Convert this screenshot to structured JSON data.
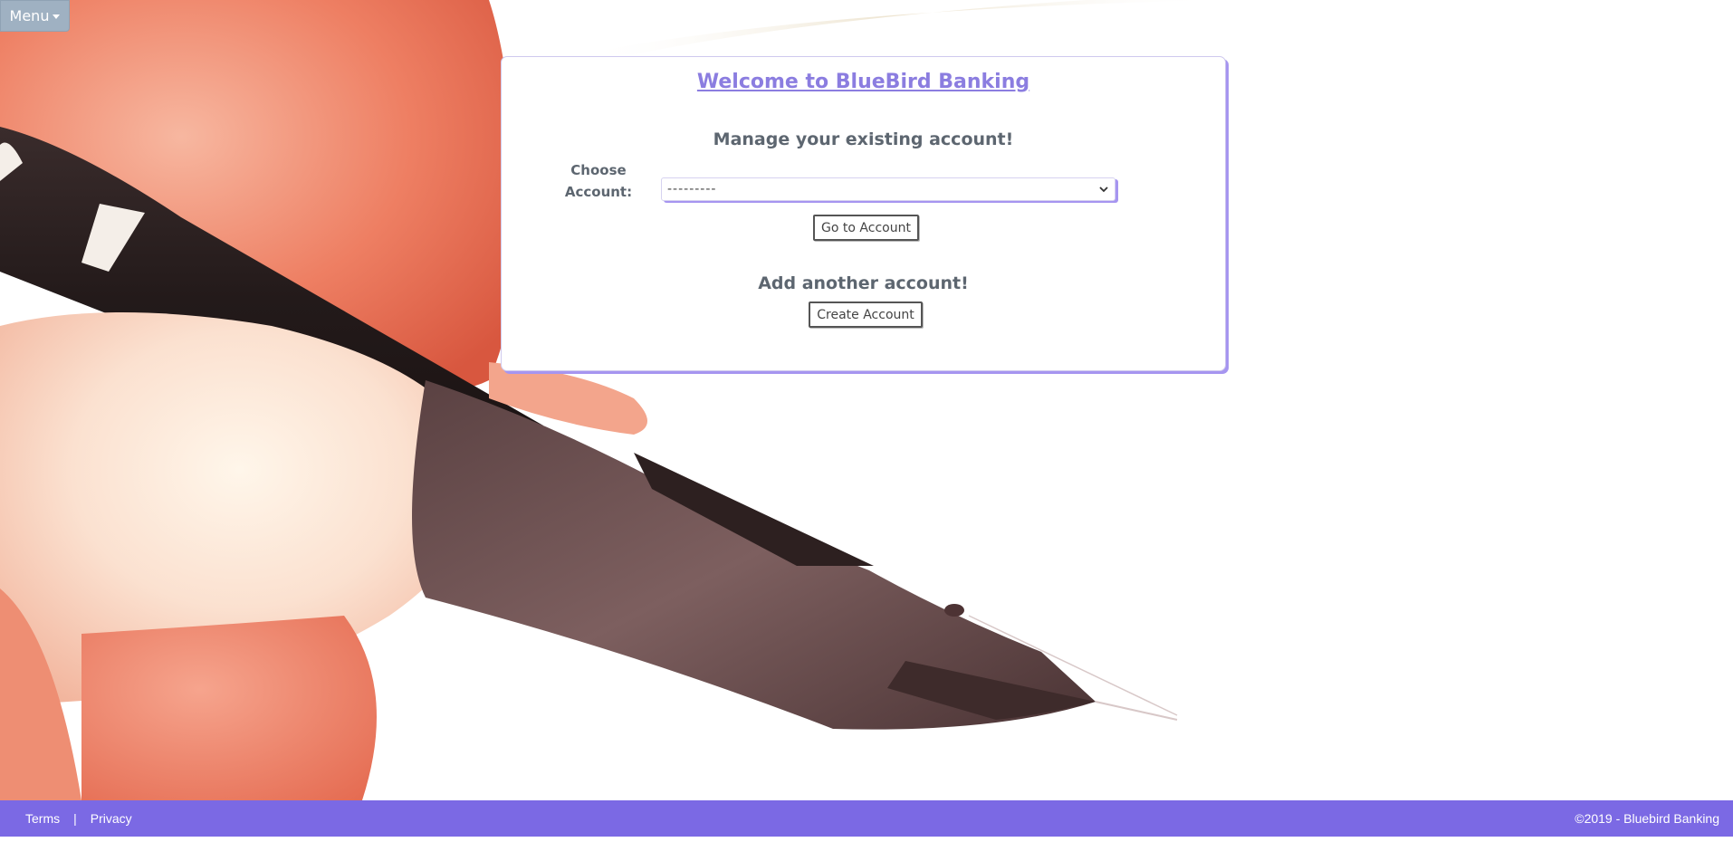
{
  "menu": {
    "label": "Menu",
    "caret_icon": "caret-down-icon"
  },
  "card": {
    "title": "Welcome to BlueBird Banking",
    "manage_heading": "Manage your existing account!",
    "choose_label": "Choose Account:",
    "select": {
      "selected_value": "---------",
      "icon": "chevron-down-icon"
    },
    "go_button_label": "Go to Account",
    "add_heading": "Add another account!",
    "create_button_label": "Create Account"
  },
  "footer": {
    "links": [
      {
        "label": "Terms"
      },
      {
        "label": "Privacy"
      }
    ],
    "separator": "|",
    "copyright": "©2019 - Bluebird Banking"
  },
  "colors": {
    "accent": "#7b69e4",
    "title": "#8b7de0",
    "menu_bg": "#9fb1c2",
    "text": "#5d6670"
  },
  "background": {
    "image": "hand-holding-fountain-pen"
  }
}
